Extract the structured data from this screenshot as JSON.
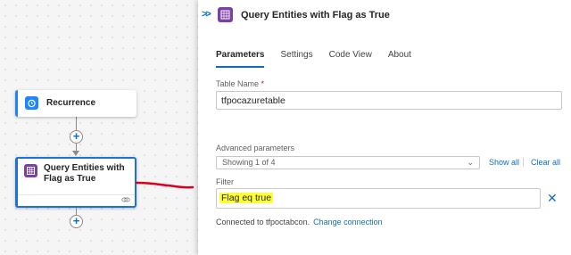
{
  "canvas": {
    "recurrence_node": {
      "title": "Recurrence",
      "icon": "alarm-clock-icon",
      "color": "#1f85ff"
    },
    "query_node": {
      "title": "Query Entities with Flag as True",
      "icon": "table-storage-icon",
      "color": "#7b3fa8"
    },
    "add_step_glyph": "+",
    "annotation_color": "#d9001b"
  },
  "panel": {
    "collapse_glyph": ">>",
    "title": "Query Entities with Flag as True",
    "tabs": [
      {
        "label": "Parameters",
        "active": true
      },
      {
        "label": "Settings",
        "active": false
      },
      {
        "label": "Code View",
        "active": false
      },
      {
        "label": "About",
        "active": false
      }
    ],
    "table_name": {
      "label": "Table Name",
      "required_mark": "*",
      "value": "tfpocazuretable"
    },
    "advanced": {
      "label": "Advanced parameters",
      "selected": "Showing 1 of 4",
      "show_all": "Show all",
      "clear_all": "Clear all"
    },
    "filter": {
      "label": "Filter",
      "value": "Flag eq true",
      "highlight_color": "#ffff33"
    },
    "connection": {
      "text": "Connected to tfpoctabcon.",
      "change": "Change connection"
    },
    "accent_color": "#0f6cbd"
  }
}
